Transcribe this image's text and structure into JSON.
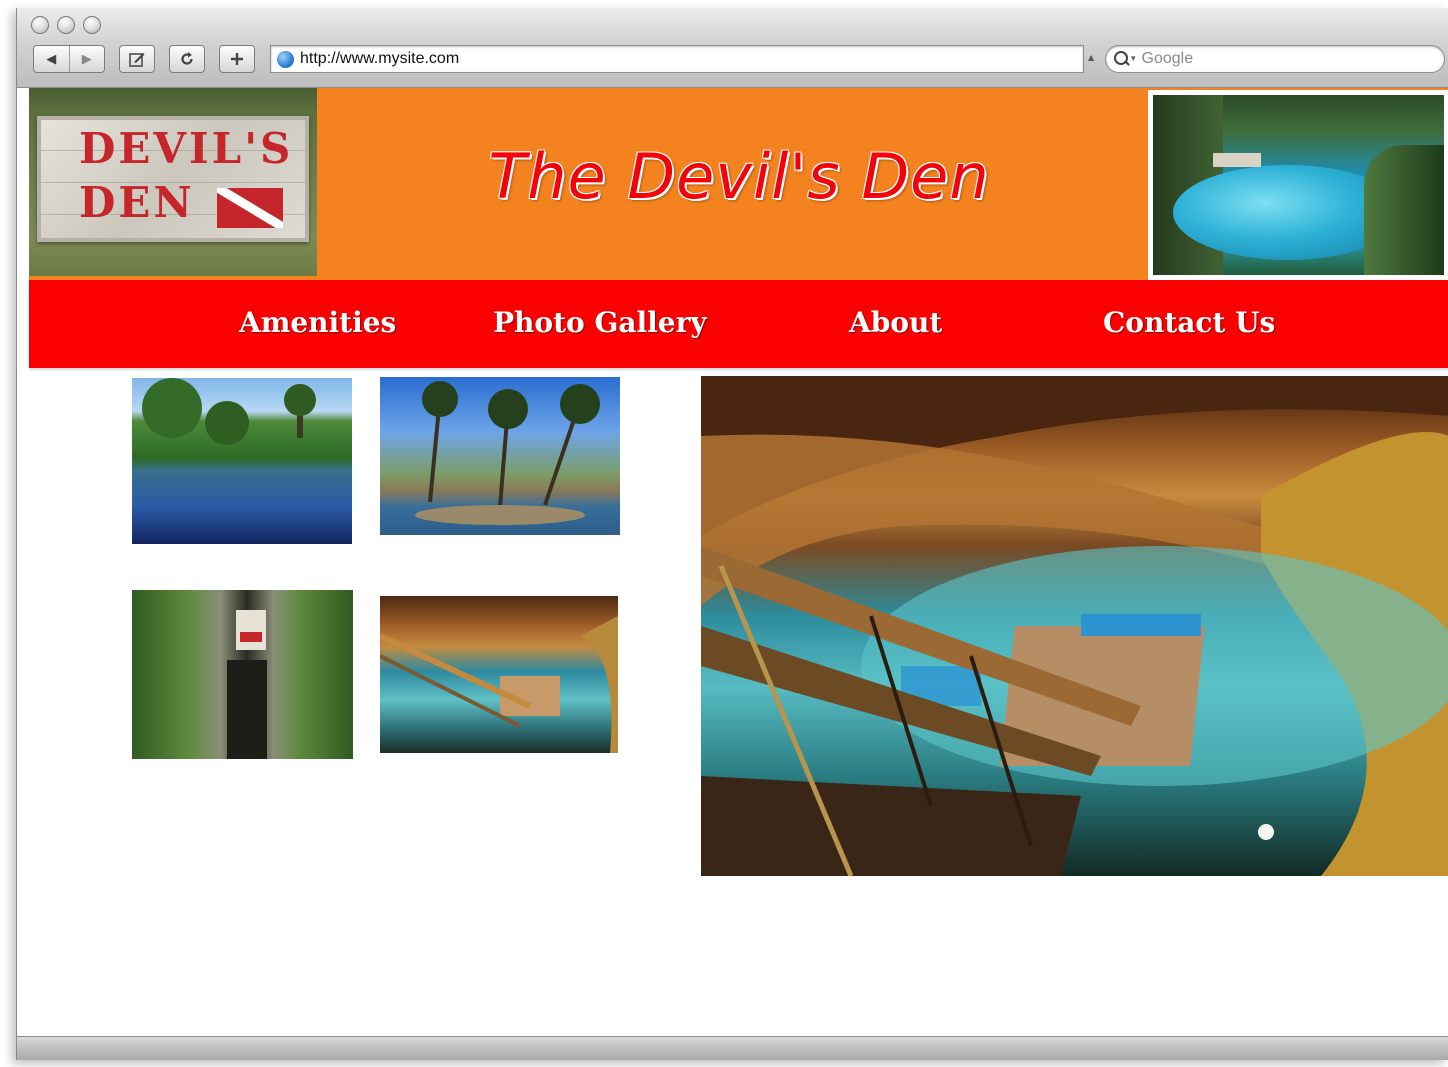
{
  "browser": {
    "address_url": "http://www.mysite.com",
    "search_placeholder": "Google"
  },
  "header": {
    "sign_word_1": "DEVIL'S",
    "sign_word_2": "DEN",
    "site_title": "The Devil's Den"
  },
  "nav": {
    "items": [
      {
        "label": "Amenities"
      },
      {
        "label": "Photo Gallery"
      },
      {
        "label": "About"
      },
      {
        "label": "Contact Us"
      }
    ]
  },
  "colors": {
    "header_background": "#f4821f",
    "nav_background": "#fa0000",
    "title_color": "#f4020b",
    "nav_text": "#ffffff"
  },
  "icons": [
    "back-icon",
    "forward-icon",
    "edit-icon",
    "reload-icon",
    "add-icon",
    "globe-icon",
    "search-icon"
  ]
}
